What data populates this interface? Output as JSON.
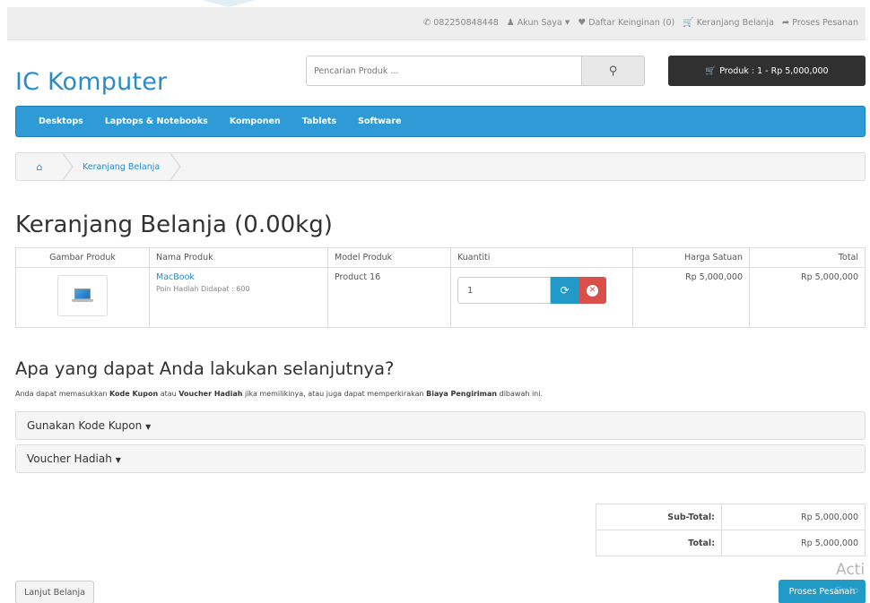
{
  "topbar": {
    "phone": "082250848448",
    "account": "Akun Saya",
    "wishlist": "Daftar Keinginan (0)",
    "cart": "Keranjang Belanja",
    "checkout": "Proses Pesanan"
  },
  "header": {
    "logo": "IC Komputer",
    "search_placeholder": "Pencarian Produk ...",
    "cart_button": "Produk : 1 - Rp 5,000,000"
  },
  "nav": {
    "items": [
      "Desktops",
      "Laptops & Notebooks",
      "Komponen",
      "Tablets",
      "Software"
    ]
  },
  "breadcrumb": {
    "items": [
      "Keranjang Belanja"
    ]
  },
  "page": {
    "title": "Keranjang Belanja  (0.00kg)"
  },
  "cart_table": {
    "headers": [
      "Gambar Produk",
      "Nama Produk",
      "Model Produk",
      "Kuantiti",
      "Harga Satuan",
      "Total"
    ],
    "rows": [
      {
        "name": "MacBook",
        "reward": "Poin Hadiah Didapat : 600",
        "model": "Product 16",
        "quantity": "1",
        "unit_price": "Rp 5,000,000",
        "total": "Rp 5,000,000"
      }
    ]
  },
  "next": {
    "title": "Apa yang dapat Anda lakukan selanjutnya?",
    "desc_1": "Anda dapat memasukkan ",
    "desc_b1": "Kode Kupon",
    "desc_2": " atau ",
    "desc_b2": "Voucher Hadiah",
    "desc_3": " jika memilikinya, atau juga dapat memperkirakan ",
    "desc_b3": "Biaya Pengiriman",
    "desc_4": " dibawah ini.",
    "panels": [
      "Gunakan Kode Kupon",
      "Voucher Hadiah"
    ]
  },
  "totals": {
    "subtotal_label": "Sub-Total:",
    "subtotal_value": "Rp 5,000,000",
    "total_label": "Total:",
    "total_value": "Rp 5,000,000"
  },
  "actions": {
    "continue": "Lanjut Belanja",
    "checkout": "Proses Pesanan"
  },
  "watermark": {
    "line1": "Acti",
    "line2": "Go to"
  },
  "colors": {
    "accent": "#2f9bd6",
    "primary_button": "#229ac8",
    "danger": "#da4f49",
    "dark_button": "#303030"
  }
}
